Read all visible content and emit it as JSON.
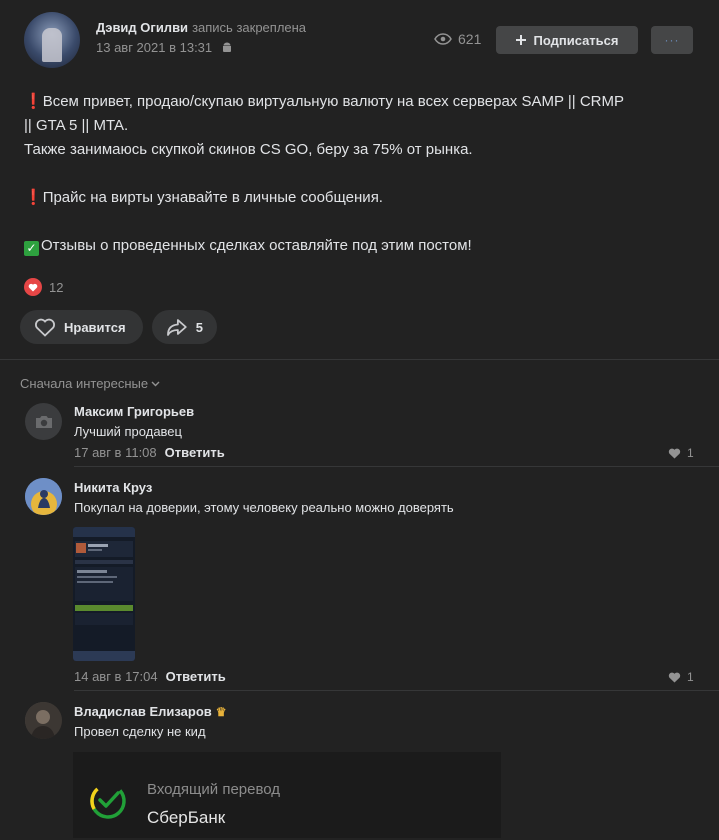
{
  "post": {
    "author": "Дэвид Огилви",
    "pinned": "запись закреплена",
    "date": "13 авг 2021 в 13:31",
    "views": "621",
    "subscribe": "Подписаться",
    "more_label": "···",
    "lines": [
      "Всем привет, продаю/скупаю виртуальную валюту на всех серверах SAMP || CRMP",
      "|| GTA 5 || MTA.",
      "Также занимаюсь скупкой скинов CS GO, беру за 75% от рынка.",
      "Прайс на вирты узнавайте в личные сообщения.",
      "Отзывы о проведенных сделках оставляйте под этим постом!"
    ],
    "reactions_count": "12",
    "like_label": "Нравится",
    "share_count": "5",
    "icons": {
      "views": "eye-icon",
      "like": "heart-outline-icon",
      "share": "share-arrow-icon",
      "platform": "android-icon"
    }
  },
  "comments_header": {
    "sort_label": "Сначала интересные"
  },
  "comments": [
    {
      "name": "Максим Григорьев",
      "text": "Лучший продавец",
      "date": "17 авг в 11:08",
      "reply": "Ответить",
      "likes": "1"
    },
    {
      "name": "Никита Круз",
      "text": "Покупал на доверии, этому человеку реально можно доверять",
      "date": "14 авг в 17:04",
      "reply": "Ответить",
      "likes": "1"
    },
    {
      "name": "Владислав Елизаров",
      "text": "Провел сделку не кид",
      "card": {
        "title": "Входящий перевод",
        "bank": "СберБанк"
      }
    }
  ],
  "colors": {
    "background": "#222222",
    "heart": "#e64646",
    "check": "#2ea13f",
    "sber": "#21a038"
  }
}
